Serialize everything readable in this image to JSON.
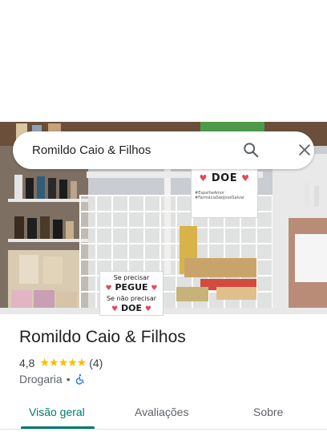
{
  "search": {
    "query": "Romildo Caio & Filhos"
  },
  "photo_signs": {
    "doe": "DOE",
    "hashtags": [
      "#EspalheAmor",
      "#FarmáciaSãoJoséSalvar"
    ],
    "pegue_line1": "Se precisar",
    "pegue_line2": "PEGUE",
    "pegue_line3": "Se não precisar",
    "pegue_line4": "DOE"
  },
  "place": {
    "title": "Romildo Caio & Filhos",
    "rating": "4,8",
    "stars": "★★★★★",
    "review_count": "(4)",
    "category": "Drogaria",
    "separator": "•"
  },
  "tabs": [
    {
      "label": "Visão geral",
      "active": true
    },
    {
      "label": "Avaliações",
      "active": false
    },
    {
      "label": "Sobre",
      "active": false
    }
  ],
  "colors": {
    "accent": "#00796b",
    "star": "#fbbc04",
    "accessibility": "#1a73e8"
  }
}
